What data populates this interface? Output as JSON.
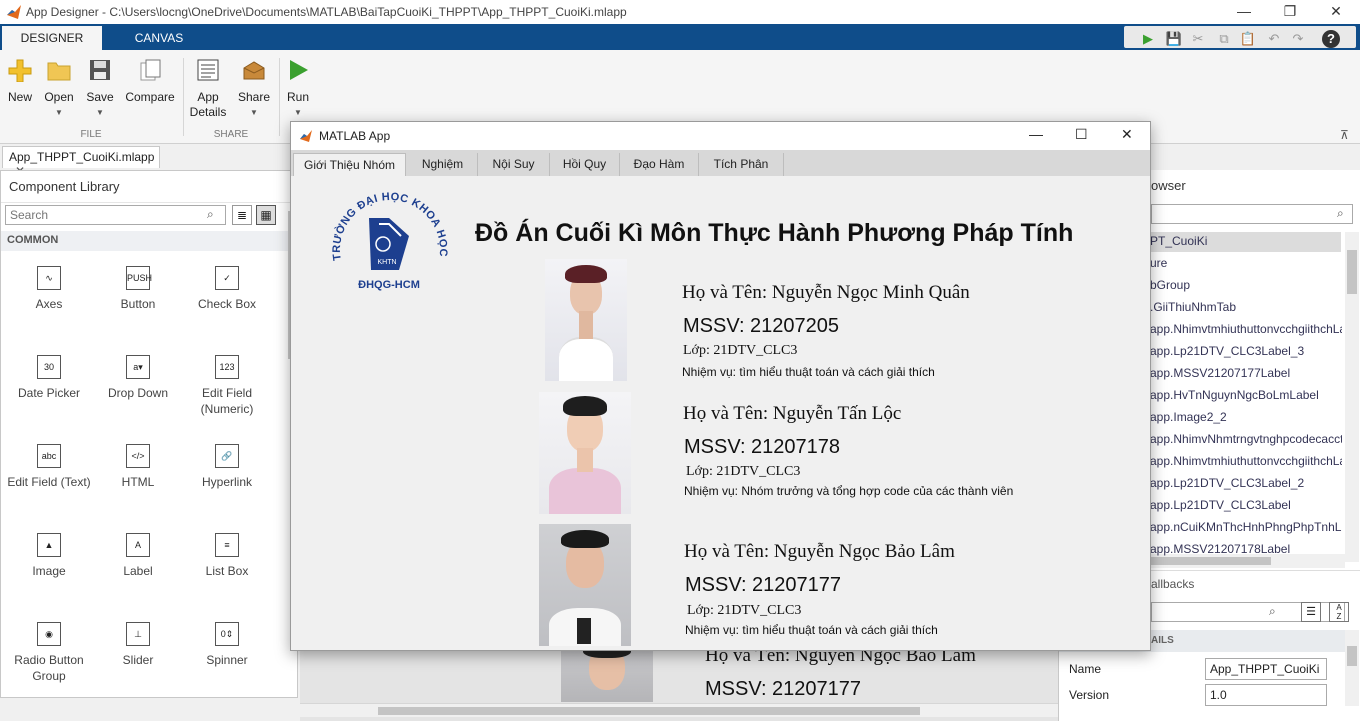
{
  "window": {
    "title": "App Designer - C:\\Users\\locng\\OneDrive\\Documents\\MATLAB\\BaiTapCuoiKi_THPPT\\App_THPPT_CuoiKi.mlapp"
  },
  "ribbon_tabs": [
    "DESIGNER",
    "CANVAS"
  ],
  "ribbon": {
    "new": "New",
    "open": "Open",
    "save": "Save",
    "compare": "Compare",
    "app_details_1": "App",
    "app_details_2": "Details",
    "share": "Share",
    "run": "Run",
    "group_file": "FILE",
    "group_share": "SHARE"
  },
  "file_tab": "App_THPPT_CuoiKi.mlapp",
  "component_library": {
    "title": "Component Library",
    "search_placeholder": "Search",
    "section": "COMMON",
    "items": [
      {
        "label": "Axes",
        "icon": "axes-icon",
        "glyph": "∿"
      },
      {
        "label": "Button",
        "icon": "button-icon",
        "glyph": "PUSH"
      },
      {
        "label": "Check Box",
        "icon": "checkbox-icon",
        "glyph": "✓"
      },
      {
        "label": "Date Picker",
        "icon": "date-picker-icon",
        "glyph": "30"
      },
      {
        "label": "Drop Down",
        "icon": "dropdown-icon",
        "glyph": "a▾"
      },
      {
        "label": "Edit Field (Numeric)",
        "icon": "numeric-field-icon",
        "glyph": "123"
      },
      {
        "label": "Edit Field (Text)",
        "icon": "text-field-icon",
        "glyph": "abc"
      },
      {
        "label": "HTML",
        "icon": "html-icon",
        "glyph": "</>"
      },
      {
        "label": "Hyperlink",
        "icon": "hyperlink-icon",
        "glyph": "🔗"
      },
      {
        "label": "Image",
        "icon": "image-icon",
        "glyph": "▲"
      },
      {
        "label": "Label",
        "icon": "label-icon",
        "glyph": "A"
      },
      {
        "label": "List Box",
        "icon": "listbox-icon",
        "glyph": "≡"
      },
      {
        "label": "Radio Button Group",
        "icon": "radio-group-icon",
        "glyph": "◉"
      },
      {
        "label": "Slider",
        "icon": "slider-icon",
        "glyph": "⊥"
      },
      {
        "label": "Spinner",
        "icon": "spinner-icon",
        "glyph": "0⇕"
      }
    ]
  },
  "component_browser": {
    "title": "owser",
    "items": [
      "PT_CuoiKi",
      "ure",
      "bGroup",
      ".GiiThiuNhmTab",
      "app.NhimvtmhiuthuttonvcchgiithchLa",
      "app.Lp21DTV_CLC3Label_3",
      "app.MSSV21207177Label",
      "app.HvTnNguynNgcBoLmLabel",
      "app.Image2_2",
      "app.NhimvNhmtrngvtnghpcodecacct",
      "app.NhimvtmhiuthuttonvcchgiithchLa",
      "app.Lp21DTV_CLC3Label_2",
      "app.Lp21DTV_CLC3Label",
      "app.nCuiKMnThcHnhPhngPhpTnhLa",
      "app.MSSV21207178Label"
    ],
    "callbacks": "allbacks",
    "details": "AILS",
    "name_label": "Name",
    "name_value": "App_THPPT_CuoiKi",
    "version_label": "Version",
    "version_value": "1.0"
  },
  "dialog": {
    "title": "MATLAB App",
    "tabs": [
      "Giới Thiệu Nhóm",
      "Nghiệm",
      "Nội Suy",
      "Hồi Quy",
      "Đạo Hàm",
      "Tích Phân"
    ],
    "logo_text": "TRƯỜNG ĐẠI HỌC KHOA HỌC TỰ NHIÊN",
    "logo_badge": "KHTN",
    "logo_sub": "ĐHQG-HCM",
    "heading": "Đồ Án Cuối Kì Môn Thực Hành Phương Pháp Tính",
    "members": [
      {
        "name": "Họ và Tên: Nguyễn Ngọc Minh Quân",
        "mssv": "MSSV: 21207205",
        "lop": "Lớp: 21DTV_CLC3",
        "task": "Nhiệm vụ: tìm hiểu thuật toán và cách giải thích"
      },
      {
        "name": "Họ và Tên: Nguyễn Tấn Lộc",
        "mssv": "MSSV: 21207178",
        "lop": "Lớp: 21DTV_CLC3",
        "task": "Nhiệm vụ: Nhóm trưởng và tổng hợp code của các thành viên"
      },
      {
        "name": "Họ và Tên: Nguyễn Ngọc Bảo Lâm",
        "mssv": "MSSV: 21207177",
        "lop": "Lớp: 21DTV_CLC3",
        "task": "Nhiệm vụ: tìm hiểu thuật toán và cách giải thích"
      }
    ]
  },
  "canvas_behind": {
    "name": "Họ và Tên: Nguyễn Ngọc Bảo Lâm",
    "mssv": "MSSV: 21207177"
  },
  "colors": {
    "ribbon_tab_bg": "#0f4d8a",
    "run_green": "#3aa02f",
    "logo_blue": "#1d3f8f"
  }
}
